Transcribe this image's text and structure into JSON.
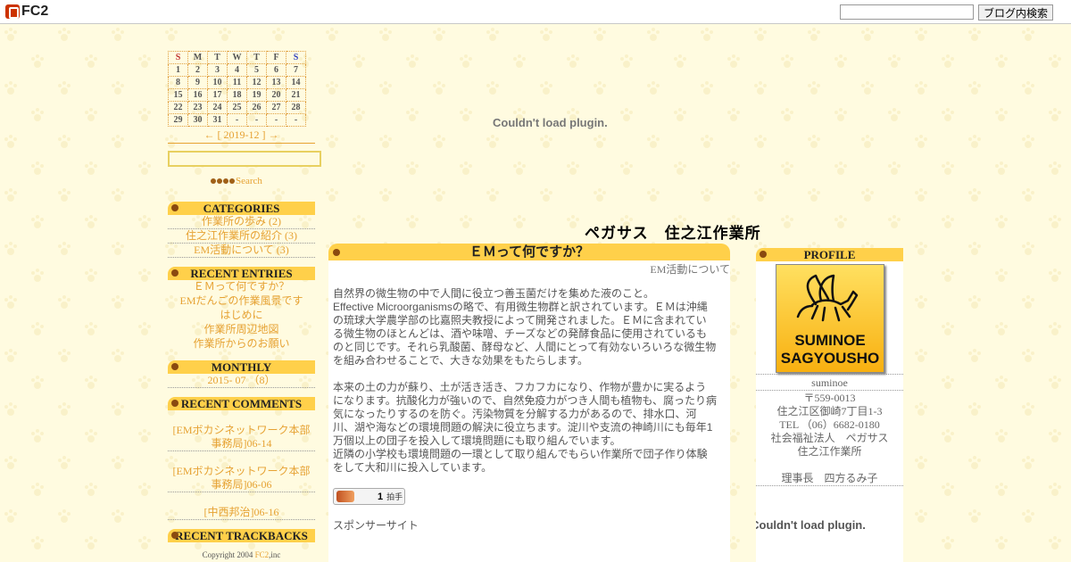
{
  "topbar": {
    "logo_text": "FC2",
    "search_placeholder": "",
    "search_button": "ブログ内検索"
  },
  "calendar": {
    "headers": [
      "S",
      "M",
      "T",
      "W",
      "T",
      "F",
      "S"
    ],
    "rows": [
      [
        "1",
        "2",
        "3",
        "4",
        "5",
        "6",
        "7"
      ],
      [
        "8",
        "9",
        "10",
        "11",
        "12",
        "13",
        "14"
      ],
      [
        "15",
        "16",
        "17",
        "18",
        "19",
        "20",
        "21"
      ],
      [
        "22",
        "23",
        "24",
        "25",
        "26",
        "27",
        "28"
      ],
      [
        "29",
        "30",
        "31",
        "-",
        "-",
        "-",
        "-"
      ]
    ],
    "nav": "← [ 2019-12 ] →"
  },
  "side_search": {
    "button": "Search"
  },
  "categories": {
    "title": "CATEGORIES",
    "items": [
      "作業所の歩み (2)",
      "住之江作業所の紹介 (3)",
      "EM活動について (3)"
    ]
  },
  "recent_entries": {
    "title": "RECENT ENTRIES",
    "items": [
      "ＥＭって何ですか？",
      "EMだんごの作業風景です",
      "はじめに",
      "作業所周辺地図",
      "作業所からのお願い"
    ]
  },
  "monthly": {
    "title": "MONTHLY",
    "items": [
      "2015- 07 （8）"
    ]
  },
  "recent_comments": {
    "title": "RECENT COMMENTS",
    "items": [
      "[EMボカシネットワーク本部事務局]06-14",
      "[EMボカシネットワーク本部事務局]06-06",
      "[中西邦治]06-16"
    ]
  },
  "recent_trackbacks": {
    "title": "RECENT TRACKBACKS"
  },
  "copyright": {
    "prefix": "Copyright 2004 ",
    "link": "FC2",
    "suffix": ",inc"
  },
  "plugin_message": "Couldn't load plugin.",
  "blog_title": "ペガサス　住之江作業所",
  "entry": {
    "title": "ＥＭって何ですか？",
    "category": "EM活動について",
    "paragraphs": [
      "自然界の微生物の中で人間に役立つ善玉菌だけを集めた液のこと。\nEffective Microorganismsの略で、有用微生物群と訳されています。ＥＭは沖縄の琉球大学農学部の比嘉照夫教授によって開発されました。ＥＭに含まれている微生物のほとんどは、酒や味噌、チーズなどの発酵食品に使用されているものと同じです。それら乳酸菌、酵母など、人間にとって有効ないろいろな微生物を組み合わせることで、大きな効果をもたらします。",
      "本来の土の力が蘇り、土が活き活き、フカフカになり、作物が豊かに実るようになります。抗酸化力が強いので、自然免疫力がつき人間も植物も、腐ったり病気になったりするのを防ぐ。汚染物質を分解する力があるので、排水口、河川、湖や海などの環境問題の解決に役立ちます。淀川や支流の神崎川にも毎年1万個以上の団子を投入して環境問題にも取り組んでいます。\n近隣の小学校も環境問題の一環として取り組んでもらい作業所で団子作り体験をして大和川に投入しています。"
    ],
    "clap_count": "1",
    "clap_label": "拍手",
    "sponsor": "スポンサーサイト"
  },
  "profile": {
    "title": "PROFILE",
    "image_text_1": "SUMINOE",
    "image_text_2": "SAGYOUSHO",
    "username": "suminoe",
    "postal": "〒559-0013",
    "address": "住之江区御崎7丁目1-3",
    "tel": "TEL （06）6682-0180",
    "org1": "社会福祉法人　ペガサス",
    "org2": "住之江作業所",
    "chief": "理事長　四方るみ子",
    "plugin_message": "Couldn't load plugin."
  }
}
